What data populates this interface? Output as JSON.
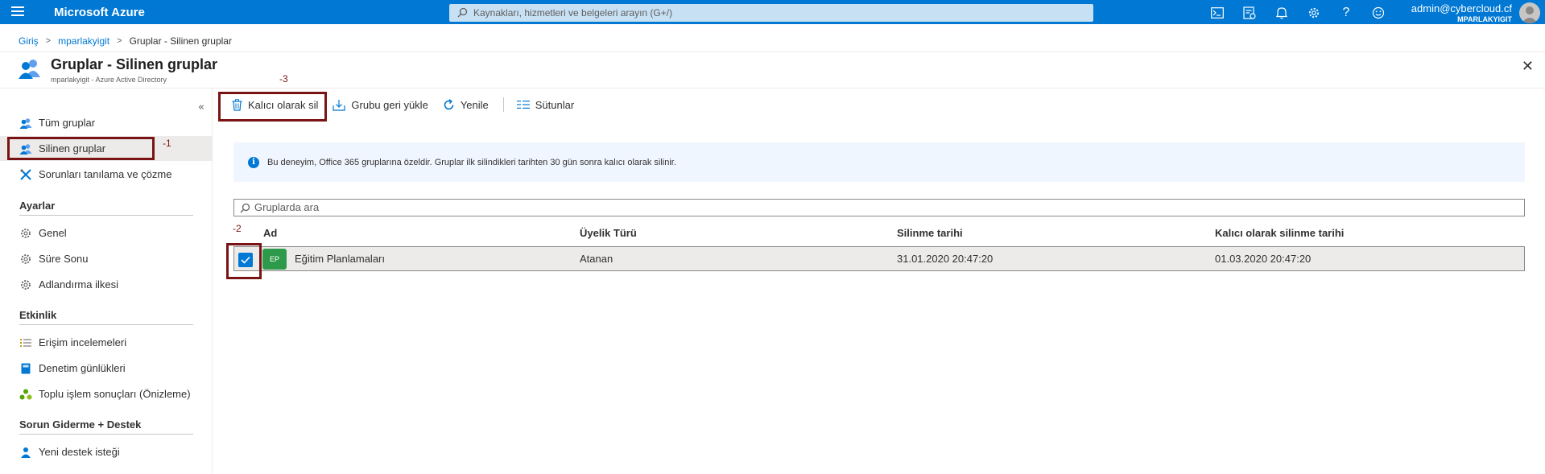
{
  "topbar": {
    "brand": "Microsoft Azure",
    "search_placeholder": "Kaynakları, hizmetleri ve belgeleri arayın (G+/)",
    "user_email": "admin@cybercloud.cf",
    "user_tenant": "MPARLAKYIGIT",
    "icons": [
      "cloud-shell-icon",
      "directory-filter-icon",
      "bell-icon",
      "gear-icon",
      "help-icon",
      "feedback-smiley-icon"
    ]
  },
  "breadcrumb": {
    "items": [
      "Giriş",
      "mparlakyigit",
      "Gruplar - Silinen gruplar"
    ]
  },
  "page": {
    "title": "Gruplar - Silinen gruplar",
    "subtitle": "mparlakyigit - Azure Active Directory"
  },
  "sidebar": {
    "items": [
      {
        "label": "Tüm gruplar",
        "icon": "group-icon"
      },
      {
        "label": "Silinen gruplar",
        "icon": "group-icon",
        "active": true
      },
      {
        "label": "Sorunları tanılama ve çözme",
        "icon": "wrench-icon"
      }
    ],
    "sections": [
      {
        "heading": "Ayarlar",
        "items": [
          {
            "label": "Genel",
            "icon": "gear-icon"
          },
          {
            "label": "Süre Sonu",
            "icon": "gear-icon"
          },
          {
            "label": "Adlandırma ilkesi",
            "icon": "gear-icon"
          }
        ]
      },
      {
        "heading": "Etkinlik",
        "items": [
          {
            "label": "Erişim incelemeleri",
            "icon": "list-icon"
          },
          {
            "label": "Denetim günlükleri",
            "icon": "log-book-icon"
          },
          {
            "label": "Toplu işlem sonuçları (Önizleme)",
            "icon": "bulk-operations-icon"
          }
        ]
      },
      {
        "heading": "Sorun Giderme + Destek",
        "items": [
          {
            "label": "Yeni destek isteği",
            "icon": "support-person-icon"
          }
        ]
      }
    ]
  },
  "toolbar": {
    "delete_label": "Kalıcı olarak sil",
    "restore_label": "Grubu geri yükle",
    "refresh_label": "Yenile",
    "columns_label": "Sütunlar"
  },
  "info": {
    "text": "Bu deneyim, Office 365 gruplarına özeldir. Gruplar ilk silindikleri tarihten 30 gün sonra kalıcı olarak silinir."
  },
  "groups_search": {
    "placeholder": "Gruplarda ara"
  },
  "table": {
    "columns": [
      "Ad",
      "Üyelik Türü",
      "Silinme tarihi",
      "Kalıcı olarak silinme tarihi"
    ],
    "rows": [
      {
        "initials": "EP",
        "name": "Eğitim Planlamaları",
        "membership": "Atanan",
        "deleted": "31.01.2020 20:47:20",
        "purge": "01.03.2020 20:47:20",
        "selected": true
      }
    ]
  },
  "annotations": {
    "step1": "-1",
    "step2": "-2",
    "step3": "-3",
    "color": "#7a1414"
  },
  "colors": {
    "accent": "#0078d4",
    "group_badge": "#2d9a4b"
  }
}
